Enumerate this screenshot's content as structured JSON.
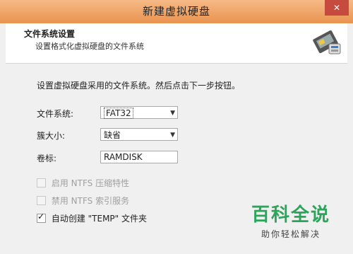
{
  "window": {
    "title": "新建虚拟硬盘",
    "close_glyph": "✕"
  },
  "header": {
    "title": "文件系统设置",
    "subtitle": "设置格式化虚拟硬盘的文件系统",
    "icon": "disk-settings-icon"
  },
  "content": {
    "intro": "设置虚拟硬盘采用的文件系统。然后点击下一步按钮。",
    "filesystem": {
      "label": "文件系统:",
      "value": "FAT32"
    },
    "cluster_size": {
      "label": "簇大小:",
      "value": "缺省"
    },
    "volume_label": {
      "label": "卷标:",
      "value": "RAMDISK"
    },
    "options": [
      {
        "label": "启用 NTFS 压缩特性",
        "checked": false,
        "enabled": false
      },
      {
        "label": "禁用 NTFS 索引服务",
        "checked": false,
        "enabled": false
      },
      {
        "label": "自动创建 \"TEMP\" 文件夹",
        "checked": true,
        "enabled": true
      }
    ]
  },
  "watermark": {
    "main": "百科全说",
    "sub": "助你轻松解决"
  },
  "colors": {
    "titlebar": "#e9934f",
    "close": "#c64a3d",
    "watermark": "#2aa55a"
  }
}
